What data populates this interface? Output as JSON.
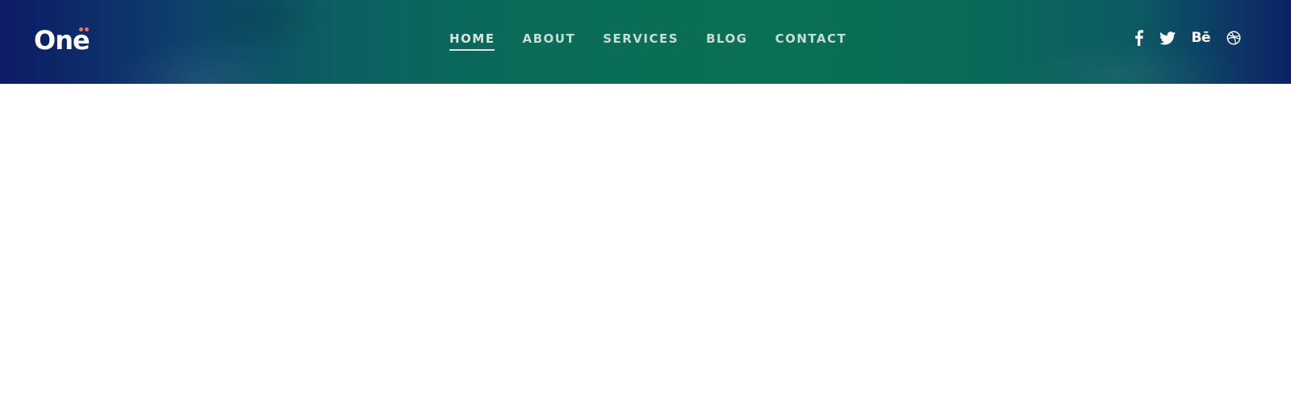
{
  "brand": {
    "logo_text": "One",
    "accent_color": "#ef6f60"
  },
  "header": {
    "gradient_colors": [
      "#0d1a66",
      "#0a7055",
      "#0d2266"
    ]
  },
  "nav": {
    "items": [
      {
        "label": "HOME",
        "active": true
      },
      {
        "label": "ABOUT",
        "active": false
      },
      {
        "label": "SERVICES",
        "active": false
      },
      {
        "label": "BLOG",
        "active": false
      },
      {
        "label": "CONTACT",
        "active": false
      }
    ]
  },
  "social": {
    "icons": [
      "facebook-icon",
      "twitter-icon",
      "behance-icon",
      "dribbble-icon"
    ],
    "behance_label": "Bē"
  }
}
